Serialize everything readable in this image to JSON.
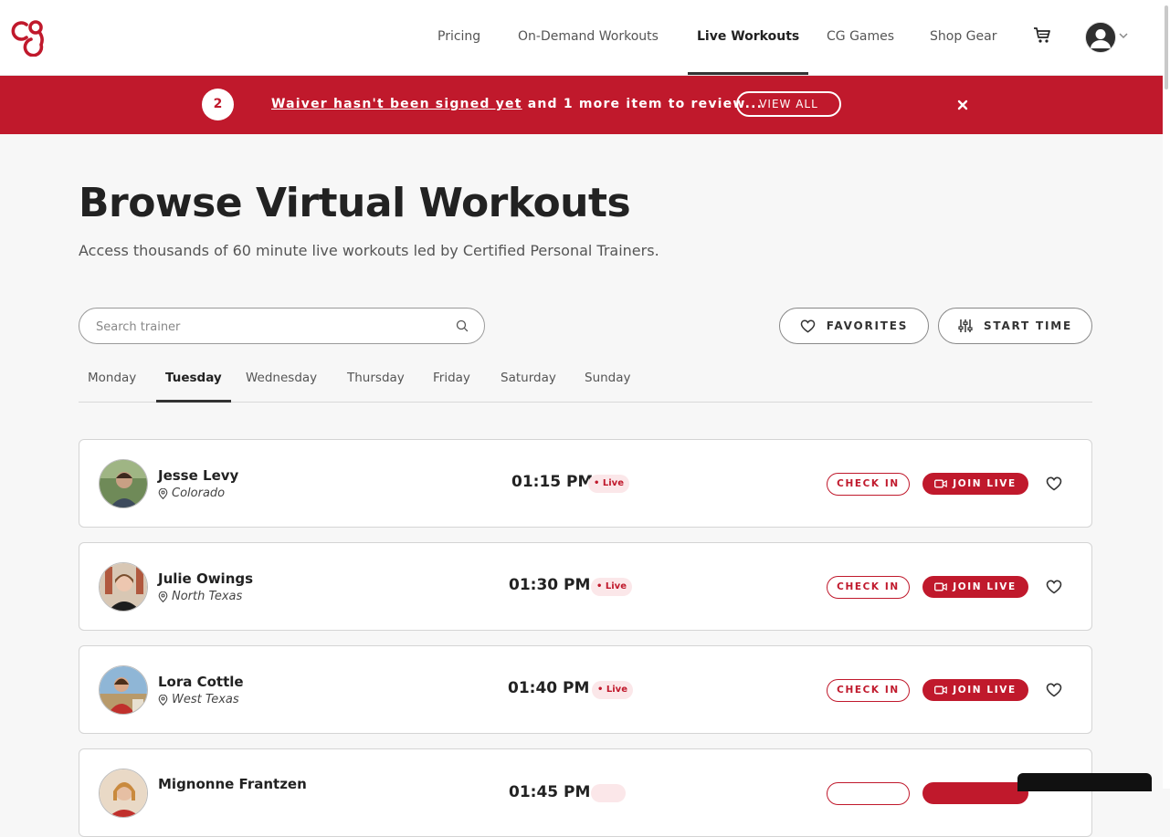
{
  "header": {
    "logo": "cg-logo",
    "nav": [
      {
        "label": "Pricing",
        "active": false
      },
      {
        "label": "On-Demand Workouts",
        "active": false
      },
      {
        "label": "Live Workouts",
        "active": true
      },
      {
        "label": "CG Games",
        "active": false
      },
      {
        "label": "Shop Gear",
        "active": false
      }
    ],
    "cart_icon": "cart-icon",
    "avatar_icon": "user-avatar-icon"
  },
  "banner": {
    "count": "2",
    "link_text": "Waiver hasn't been signed yet",
    "rest_text": " and 1 more item to review...",
    "view_all": "VIEW ALL",
    "close_icon": "close-icon"
  },
  "hero": {
    "title": "Browse Virtual Workouts",
    "subtitle": "Access thousands of 60 minute live workouts led by Certified Personal Trainers."
  },
  "search": {
    "placeholder": "Search trainer",
    "value": ""
  },
  "filters": {
    "favorites": "FAVORITES",
    "start_time": "START TIME"
  },
  "days": [
    {
      "label": "Monday",
      "active": false
    },
    {
      "label": "Tuesday",
      "active": true
    },
    {
      "label": "Wednesday",
      "active": false
    },
    {
      "label": "Thursday",
      "active": false
    },
    {
      "label": "Friday",
      "active": false
    },
    {
      "label": "Saturday",
      "active": false
    },
    {
      "label": "Sunday",
      "active": false
    }
  ],
  "workouts": [
    {
      "name": "Jesse Levy",
      "location": "Colorado",
      "time": "01:15 PM",
      "badge": "• Live",
      "check_in": "CHECK IN",
      "join": "JOIN LIVE"
    },
    {
      "name": "Julie Owings",
      "location": "North Texas",
      "time": "01:30 PM",
      "badge": "• Live",
      "check_in": "CHECK IN",
      "join": "JOIN LIVE"
    },
    {
      "name": "Lora Cottle",
      "location": "West Texas",
      "time": "01:40 PM",
      "badge": "• Live",
      "check_in": "CHECK IN",
      "join": "JOIN LIVE"
    },
    {
      "name": "Mignonne Frantzen",
      "location": "",
      "time": "01:45 PM",
      "badge": "",
      "check_in": "",
      "join": ""
    }
  ],
  "colors": {
    "brand_red": "#c0192c",
    "live_badge_bg": "#fbe7e9",
    "page_bg": "#f7f7f7"
  }
}
